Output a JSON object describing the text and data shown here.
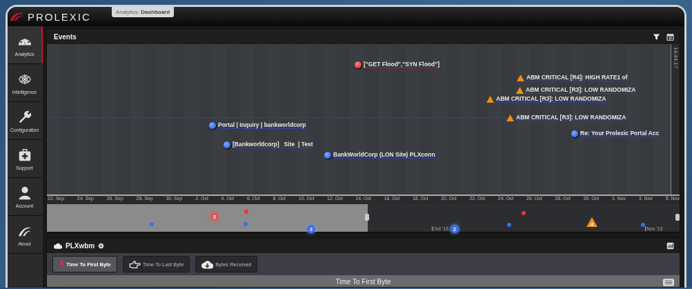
{
  "top_bar": {
    "logo": "PROLEXIC",
    "breadcrumb": {
      "section": "Analytics:",
      "page": "Dashboard"
    }
  },
  "sidebar": {
    "items": [
      {
        "kind": "gauge",
        "label": "Analytics",
        "selected": true
      },
      {
        "kind": "tangle",
        "label": "Intelligence",
        "selected": false
      },
      {
        "kind": "wrench",
        "label": "Configuration",
        "selected": false
      },
      {
        "kind": "medkit",
        "label": "Support",
        "selected": false
      },
      {
        "kind": "person",
        "label": "Account",
        "selected": false
      },
      {
        "kind": "swoosh",
        "label": "About",
        "selected": false
      }
    ]
  },
  "events_panel": {
    "title": "Events",
    "time_label": "14:44:17",
    "events": [
      {
        "kind": "red-dot",
        "label": "[\"GET Flood\",\"SYN Flood\"]"
      },
      {
        "kind": "triangle",
        "label": "ABM CRITICAL [R4]: HIGH RATE1 of"
      },
      {
        "kind": "triangle",
        "label": "ABM CRITICAL [R3]: LOW RANDOMIZA"
      },
      {
        "kind": "triangle",
        "label": "ABM CRITICAL [R3]: LOW RANDOMIZA"
      },
      {
        "kind": "triangle",
        "label": "ABM CRITICAL [R3]: LOW RANDOMIZA"
      },
      {
        "kind": "blue-dot",
        "label": "Portal | Inquiry | bankworldcorp"
      },
      {
        "kind": "blue-dot",
        "label": "Re: Your Prolexic Portal Acc"
      },
      {
        "kind": "blue-dot",
        "label": "[Bankworldcorp]   Site  | Test"
      },
      {
        "kind": "blue-dot",
        "label": "BankWorldCorp (LON Site) PLXconn"
      }
    ],
    "axis_labels": [
      "22. Sep",
      "24. Sep",
      "26. Sep",
      "28. Sep",
      "30. Sep",
      "2. Oct",
      "4. Oct",
      "6. Oct",
      "8. Oct",
      "10. Oct",
      "12. Oct",
      "14. Oct",
      "16. Oct",
      "18. Oct",
      "20. Oct",
      "22. Oct",
      "24. Oct",
      "26. Oct",
      "28. Oct",
      "30. Oct",
      "1. Nov",
      "3. Nov",
      "5. Nov"
    ],
    "navigator": {
      "markers": [
        {
          "kind": "red-dot",
          "count": "2"
        },
        {
          "kind": "red-dot"
        },
        {
          "kind": "blue-dot"
        },
        {
          "kind": "blue-dot"
        },
        {
          "kind": "blue-dot",
          "count": "2"
        },
        {
          "kind": "blue-dot",
          "count": "2"
        },
        {
          "kind": "blue-dot"
        },
        {
          "kind": "red-dot"
        },
        {
          "kind": "triangle",
          "count": "4"
        },
        {
          "kind": "blue-dot"
        }
      ],
      "month_labels": [
        "Oct '13",
        "Nov '13"
      ]
    }
  },
  "widget": {
    "title": "PLXwbm",
    "tabs": [
      {
        "kind": "bolt",
        "label": "Time To First Byte",
        "selected": true
      },
      {
        "kind": "hand",
        "label": "Time To Last Byte",
        "selected": false
      },
      {
        "kind": "cloud-download",
        "label": "Bytes Received",
        "selected": false
      }
    ],
    "chart_title": "Time To First Byte"
  }
}
